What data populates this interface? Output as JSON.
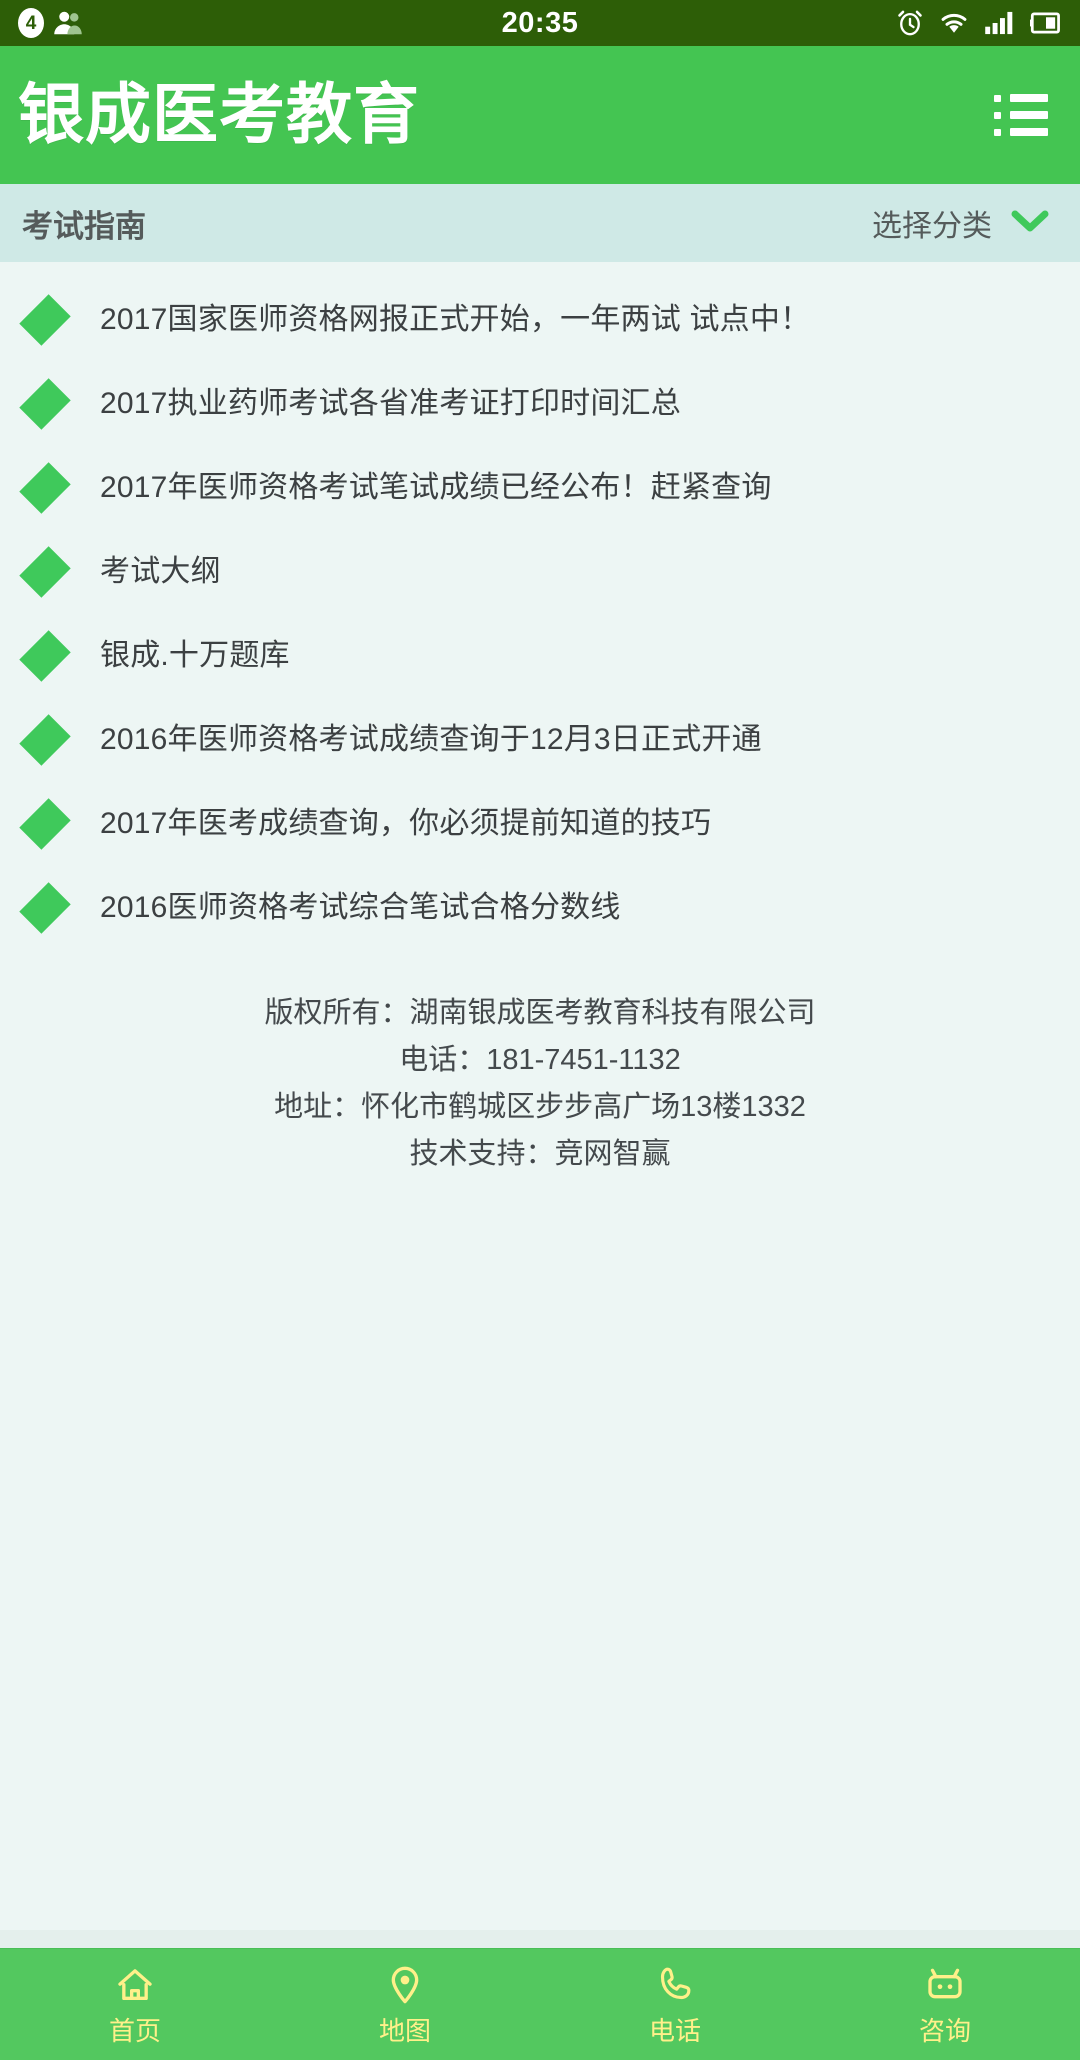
{
  "status_bar": {
    "notification_count": "4",
    "time": "20:35",
    "icons": [
      "notification-badge",
      "contacts-icon",
      "alarm-icon",
      "wifi-icon",
      "signal-icon",
      "battery-icon"
    ],
    "background_color": "#2D5E07"
  },
  "header": {
    "logo_text": "银成医考教育",
    "menu_icon": "list-menu-icon",
    "background_color": "#44C552"
  },
  "sub_header": {
    "title": "考试指南",
    "category_label": "选择分类",
    "chevron_icon": "chevron-down-icon",
    "background_color": "#CFE9E6",
    "chevron_color": "#3FC95B"
  },
  "guide_list": {
    "bullet_icon": "diamond-bullet-icon",
    "bullet_color": "#3FC95B",
    "items": [
      {
        "text": "2017国家医师资格网报正式开始，一年两试 试点中！"
      },
      {
        "text": "2017执业药师考试各省准考证打印时间汇总"
      },
      {
        "text": "2017年医师资格考试笔试成绩已经公布！赶紧查询"
      },
      {
        "text": "考试大纲"
      },
      {
        "text": "银成.十万题库"
      },
      {
        "text": "2016年医师资格考试成绩查询于12月3日正式开通"
      },
      {
        "text": "2017年医考成绩查询，你必须提前知道的技巧"
      },
      {
        "text": "2016医师资格考试综合笔试合格分数线"
      }
    ]
  },
  "footer_info": {
    "copyright": "版权所有：湖南银成医考教育科技有限公司",
    "phone": "电话：181-7451-1132",
    "address": "地址：怀化市鹤城区步步高广场13楼1332",
    "tech_support": "技术支持：竞网智赢"
  },
  "bottom_nav": {
    "background_color": "#53C85F",
    "label_color": "#FFF08A",
    "items": [
      {
        "label": "首页",
        "icon": "home-icon"
      },
      {
        "label": "地图",
        "icon": "location-pin-icon"
      },
      {
        "label": "电话",
        "icon": "phone-icon"
      },
      {
        "label": "咨询",
        "icon": "chat-bubble-icon"
      }
    ]
  }
}
